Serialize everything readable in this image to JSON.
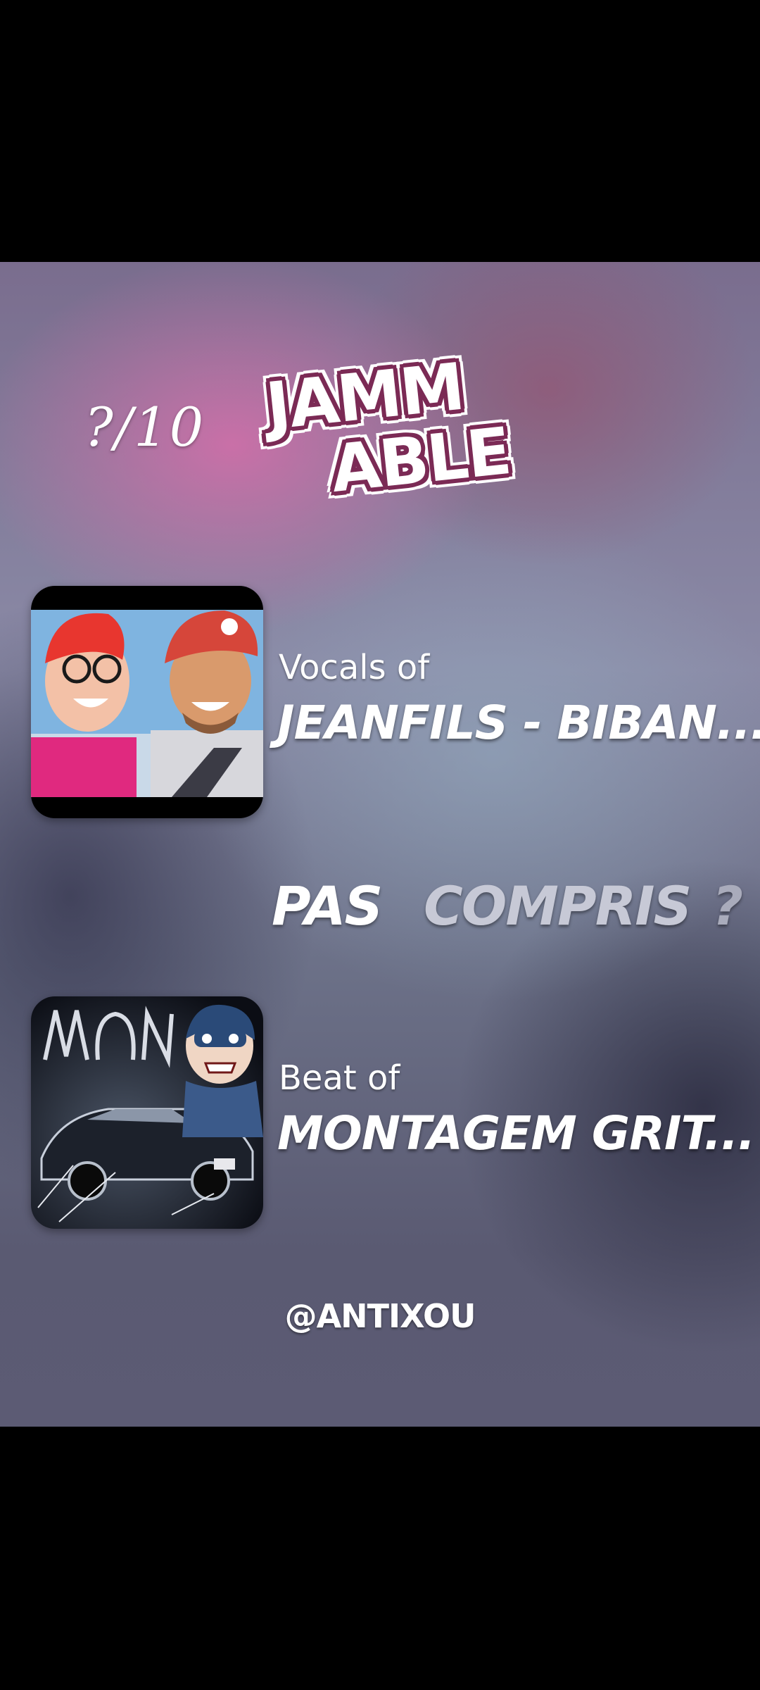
{
  "overlay": {
    "score": "?/10",
    "logo": {
      "line1": "JAMM",
      "line2": "ABLE"
    }
  },
  "tracks": [
    {
      "label": "Vocals of",
      "title": "JEANFILS - BIBAN...",
      "cover_icon": "album-cover-image"
    },
    {
      "label": "Beat of",
      "title": "MONTAGEM GRIT...",
      "cover_icon": "album-cover-image"
    }
  ],
  "verdict": {
    "word1": "PAS",
    "word2": "COMPRIS",
    "mark": "?"
  },
  "handle": "@ANTIXOU",
  "colors": {
    "logo_outline": "#7b2a55",
    "verdict_active": "#ffffff",
    "verdict_inactive": "#c7c9d6",
    "letterbox": "#000000"
  }
}
